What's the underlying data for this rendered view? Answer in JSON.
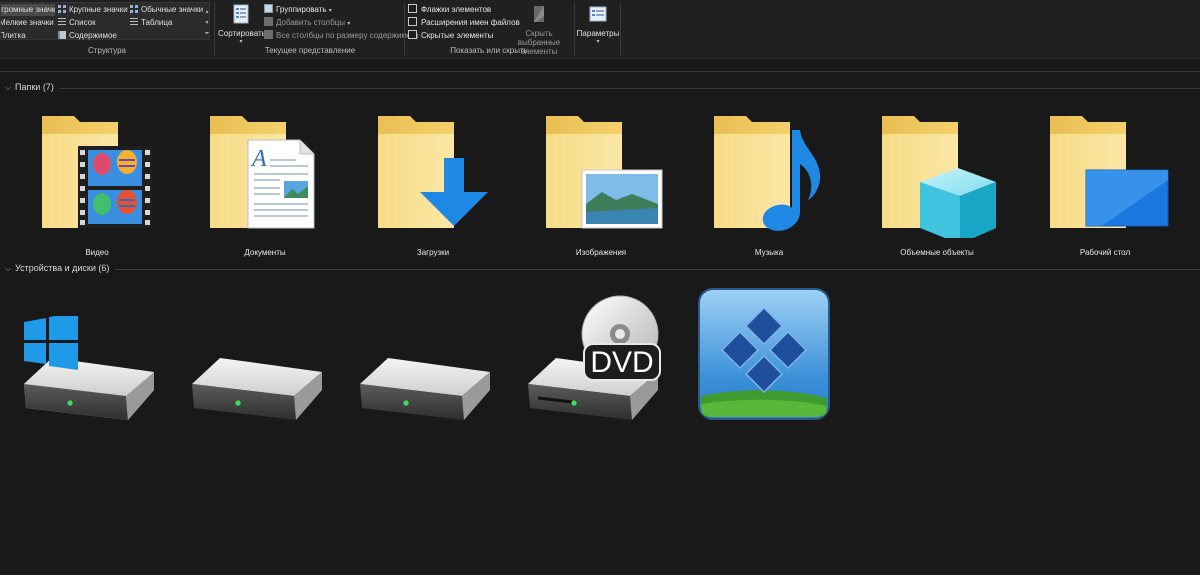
{
  "ribbon": {
    "layout": {
      "options": [
        "Огромные значки",
        "Крупные значки",
        "Обычные значки",
        "Мелкие значки",
        "Список",
        "Таблица",
        "Плитка",
        "Содержимое"
      ],
      "label": "Структура"
    },
    "current_view": {
      "sort_label": "Сортировать",
      "group_by": "Группировать",
      "add_columns": "Добавить столбцы",
      "fit_columns": "Все столбцы по размеру содержимого",
      "label": "Текущее представление"
    },
    "show_hide": {
      "item_checkboxes": "Флажки элементов",
      "file_extensions": "Расширения имен файлов",
      "hidden_items": "Скрытые элементы",
      "hide_selected_line1": "Скрыть выбранные",
      "hide_selected_line2": "элементы",
      "label": "Показать или скрыть"
    },
    "options_label": "Параметры"
  },
  "sections": {
    "folders": {
      "header": "Папки (7)",
      "items": [
        "Видео",
        "Документы",
        "Загрузки",
        "Изображения",
        "Музыка",
        "Объемные объекты",
        "Рабочий стол"
      ]
    },
    "devices": {
      "header": "Устройства и диски (6)"
    }
  },
  "icons": {
    "folders": [
      "video-folder-icon",
      "documents-folder-icon",
      "downloads-folder-icon",
      "pictures-folder-icon",
      "music-folder-icon",
      "3d-objects-folder-icon",
      "desktop-folder-icon"
    ],
    "devices": [
      "windows-drive-icon",
      "hard-drive-icon",
      "hard-drive-icon",
      "dvd-drive-icon",
      "windows-app-icon"
    ]
  },
  "colors": {
    "background": "#191919",
    "ribbon": "#202020",
    "folder": "#f6d673",
    "accent_blue": "#1e88e5"
  }
}
